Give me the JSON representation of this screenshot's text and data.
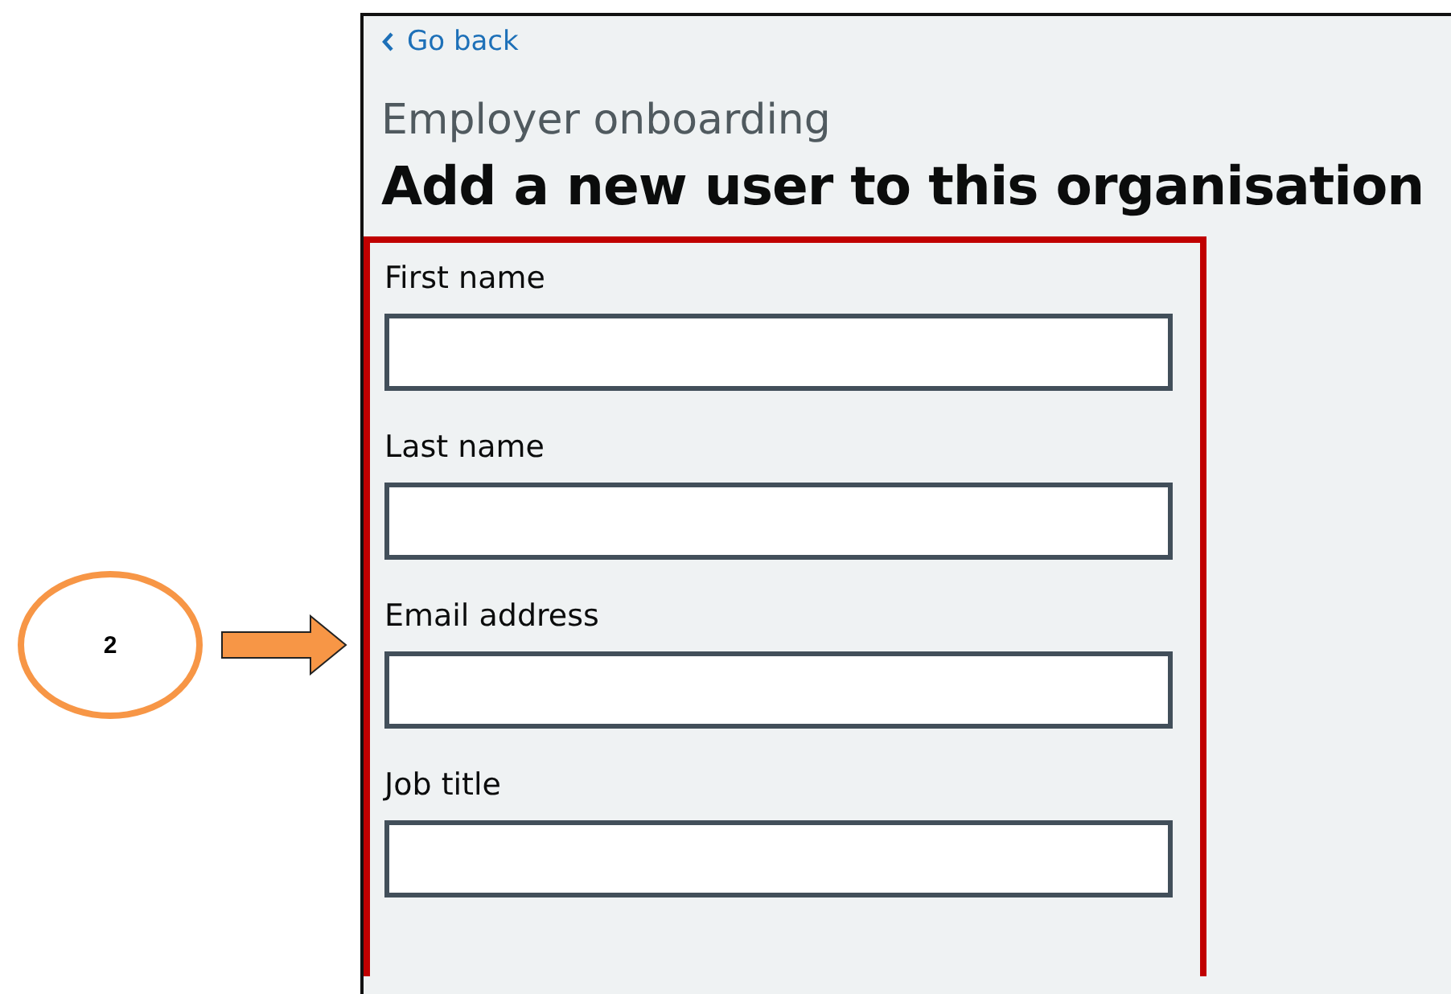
{
  "annotation": {
    "step": "2"
  },
  "page": {
    "back_link": "Go back",
    "caption": "Employer onboarding",
    "heading": "Add a new user to this organisation"
  },
  "form": {
    "fields": [
      {
        "label": "First name"
      },
      {
        "label": "Last name"
      },
      {
        "label": "Email address"
      },
      {
        "label": "Job title"
      }
    ]
  }
}
